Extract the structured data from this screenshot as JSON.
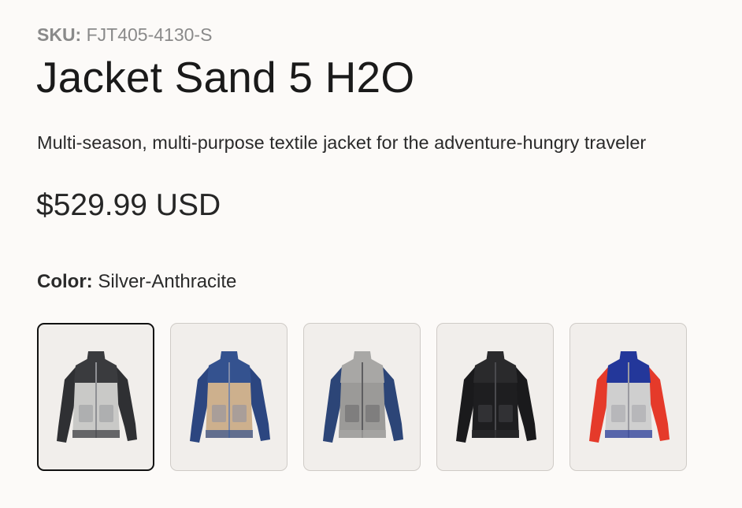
{
  "product": {
    "sku_label": "SKU:",
    "sku_value": "FJT405-4130-S",
    "title": "Jacket Sand 5 H2O",
    "description": "Multi-season, multi-purpose textile jacket for the adventure-hungry traveler",
    "price": "$529.99 USD"
  },
  "color": {
    "label": "Color:",
    "selected_value": "Silver-Anthracite"
  },
  "swatches": [
    {
      "icon": "jacket-silver-anthracite-icon",
      "colors": {
        "body": "#c9c9c7",
        "sleeve": "#2f3033",
        "yoke": "#3a3b3e",
        "detail": "#8f9094"
      },
      "selected": true
    },
    {
      "icon": "jacket-sand-blue-icon",
      "colors": {
        "body": "#cdb08d",
        "sleeve": "#2c4680",
        "yoke": "#34528f",
        "detail": "#7e8aa8"
      },
      "selected": false
    },
    {
      "icon": "jacket-grey-blue-icon",
      "colors": {
        "body": "#9b9a98",
        "sleeve": "#2c4577",
        "yoke": "#a8a7a5",
        "detail": "#5e5e60"
      },
      "selected": false
    },
    {
      "icon": "jacket-black-icon",
      "colors": {
        "body": "#1e1e20",
        "sleeve": "#1a1a1c",
        "yoke": "#2a2a2c",
        "detail": "#4a4a4e"
      },
      "selected": false
    },
    {
      "icon": "jacket-silver-blue-red-icon",
      "colors": {
        "body": "#cfcfcf",
        "sleeve": "#e53a2a",
        "yoke": "#23379a",
        "detail": "#9a9aa0"
      },
      "selected": false
    }
  ]
}
